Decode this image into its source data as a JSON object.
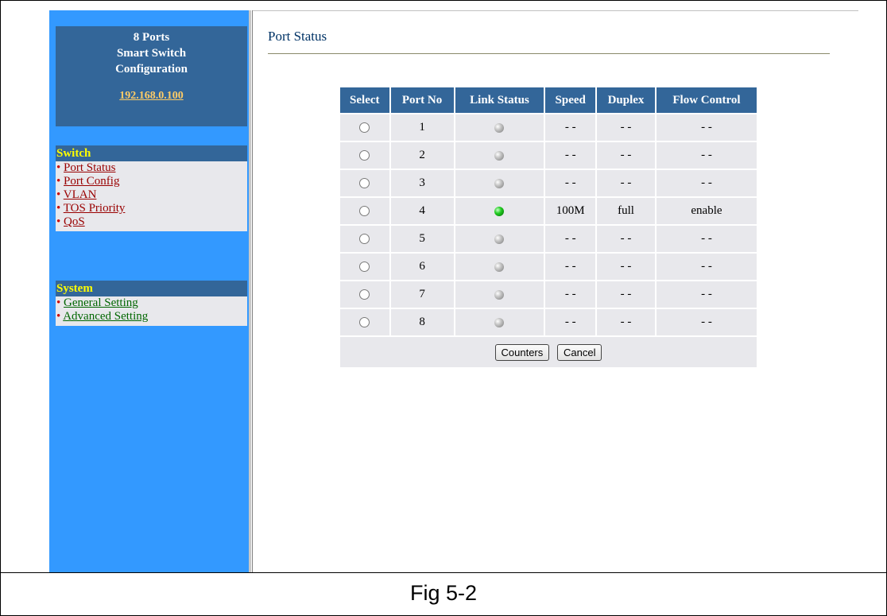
{
  "sidebar": {
    "title_line1": "8 Ports",
    "title_line2": "Smart Switch",
    "title_line3": "Configuration",
    "ip_link": "192.168.0.100",
    "switch_section": {
      "title": "Switch",
      "items": [
        "Port Status",
        "Port Config",
        "VLAN",
        "TOS Priority",
        "QoS"
      ]
    },
    "system_section": {
      "title": "System",
      "items": [
        "General Setting",
        "Advanced Setting"
      ]
    }
  },
  "main": {
    "page_title": "Port Status",
    "table": {
      "headers": [
        "Select",
        "Port No",
        "Link Status",
        "Speed",
        "Duplex",
        "Flow Control"
      ],
      "rows": [
        {
          "port": "1",
          "link": "down",
          "speed": "- -",
          "duplex": "- -",
          "flow": "- -"
        },
        {
          "port": "2",
          "link": "down",
          "speed": "- -",
          "duplex": "- -",
          "flow": "- -"
        },
        {
          "port": "3",
          "link": "down",
          "speed": "- -",
          "duplex": "- -",
          "flow": "- -"
        },
        {
          "port": "4",
          "link": "up",
          "speed": "100M",
          "duplex": "full",
          "flow": "enable"
        },
        {
          "port": "5",
          "link": "down",
          "speed": "- -",
          "duplex": "- -",
          "flow": "- -"
        },
        {
          "port": "6",
          "link": "down",
          "speed": "- -",
          "duplex": "- -",
          "flow": "- -"
        },
        {
          "port": "7",
          "link": "down",
          "speed": "- -",
          "duplex": "- -",
          "flow": "- -"
        },
        {
          "port": "8",
          "link": "down",
          "speed": "- -",
          "duplex": "- -",
          "flow": "- -"
        }
      ]
    },
    "buttons": {
      "counters": "Counters",
      "cancel": "Cancel"
    }
  },
  "caption": "Fig 5-2",
  "colors": {
    "sidebar_bg": "#3399ff",
    "header_bg": "#336699",
    "section_title": "#ffff00",
    "cell_bg": "#e8e8ec",
    "link_up": "#22cc22",
    "link_down": "#9a9a9a"
  }
}
